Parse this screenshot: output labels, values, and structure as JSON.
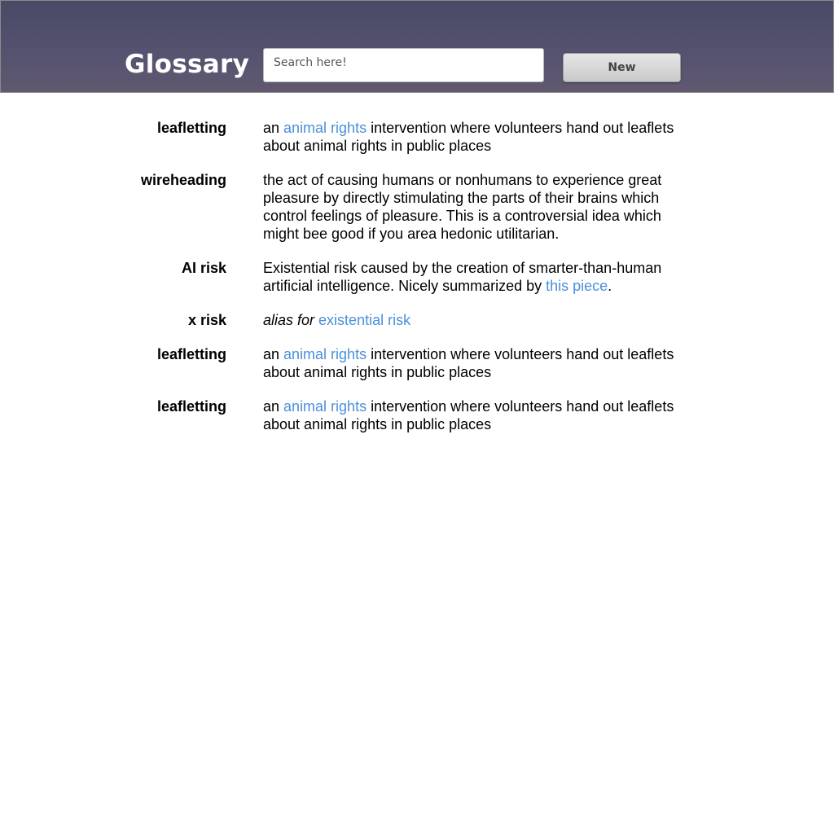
{
  "header": {
    "title": "Glossary",
    "search_placeholder": "Search here!",
    "search_value": "",
    "new_button_label": "New"
  },
  "colors": {
    "header_top": "#494a66",
    "header_bottom": "#62586f",
    "link": "#4a90d9"
  },
  "entries": [
    {
      "term": "leafletting",
      "def_before": "an ",
      "link": "animal rights",
      "def_after": " intervention where volunteers hand out leaflets about animal rights in public places"
    },
    {
      "term": "wireheading",
      "def_text": "the act of causing humans or nonhumans to experience great pleasure by directly stimulating the parts of their brains which control feelings of pleasure. This is a controversial idea which might bee good if you area hedonic utilitarian."
    },
    {
      "term": "AI risk",
      "def_before": "Existential risk caused by the creation of smarter-than-human artificial intelligence. Nicely summarized by ",
      "link": "this piece",
      "def_after": "."
    },
    {
      "term": "x risk",
      "alias_prefix": "alias for",
      "alias_link": "existential risk"
    },
    {
      "term": "leafletting",
      "def_before": "an ",
      "link": "animal rights",
      "def_after": " intervention where volunteers hand out leaflets about animal rights in public places"
    },
    {
      "term": "leafletting",
      "def_before": "an ",
      "link": "animal rights",
      "def_after": " intervention where volunteers hand out leaflets about animal rights in public places"
    }
  ]
}
